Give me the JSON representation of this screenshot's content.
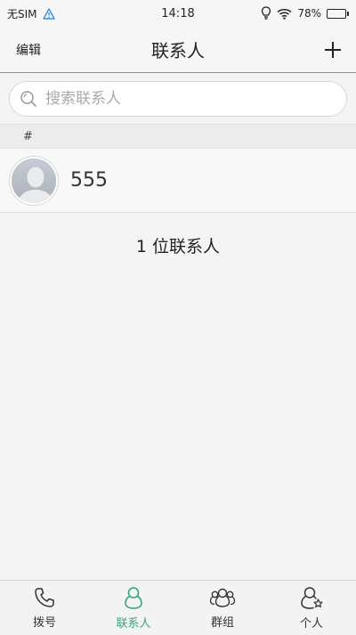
{
  "status_bar": {
    "carrier": "无SIM",
    "time": "14:18",
    "battery": "78%",
    "battery_level": 0.78
  },
  "header": {
    "edit_label": "编辑",
    "title": "联系人"
  },
  "search": {
    "placeholder": "搜索联系人"
  },
  "section": {
    "index_label": "#"
  },
  "contacts": [
    {
      "name": "555"
    }
  ],
  "summary": {
    "count_text": "1 位联系人"
  },
  "tabs": [
    {
      "label": "拨号",
      "icon": "phone-icon",
      "active": false
    },
    {
      "label": "联系人",
      "icon": "contact-icon",
      "active": true
    },
    {
      "label": "群组",
      "icon": "group-icon",
      "active": false
    },
    {
      "label": "个人",
      "icon": "personal-icon",
      "active": false
    }
  ],
  "colors": {
    "accent": "#3aa57c",
    "battery_fill": "#3cb371"
  }
}
